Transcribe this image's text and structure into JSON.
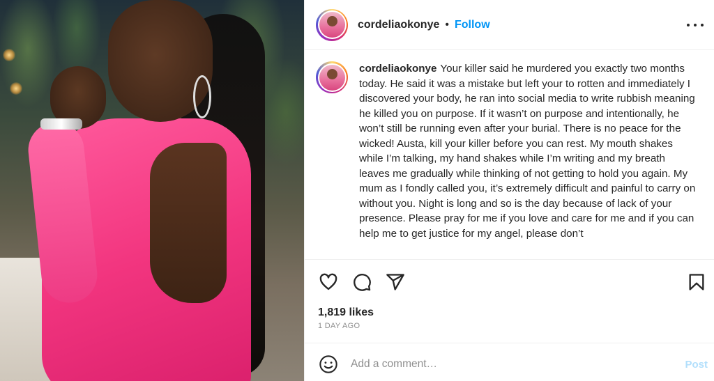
{
  "post": {
    "username": "cordeliaokonye",
    "separator": "•",
    "follow_label": "Follow",
    "caption_user": "cordeliaokonye",
    "caption_text": "Your killer said he murdered you exactly two months today. He said it was a mistake but left your to rotten and immediately I discovered your body, he ran into social media to write rubbish meaning he killed you on purpose. If it wasn’t on purpose and intentionally, he won’t still be running even after your burial. There is no peace for the wicked! Austa, kill your killer before you can rest. My mouth shakes while I’m talking, my hand shakes while I’m writing and my breath leaves me gradually while thinking of not getting to hold you again. My mum as I fondly called you, it’s extremely difficult and painful to carry on without you. Night is long and so is the day because of lack of your presence. Please pray for me if you love and care for me and if you can help me to get justice for my angel, please don’t",
    "likes": "1,819 likes",
    "timestamp": "1 DAY AGO"
  },
  "comment_box": {
    "placeholder": "Add a comment…",
    "post_label": "Post"
  },
  "icons": {
    "like": "heart-icon",
    "comment": "comment-bubble-icon",
    "share": "paper-plane-icon",
    "save": "bookmark-icon",
    "more": "more-horizontal-icon",
    "emoji": "smiley-icon"
  },
  "colors": {
    "follow": "#0095f6",
    "post_disabled": "#b2dffc",
    "text": "#262626",
    "muted": "#8e8e8e"
  }
}
